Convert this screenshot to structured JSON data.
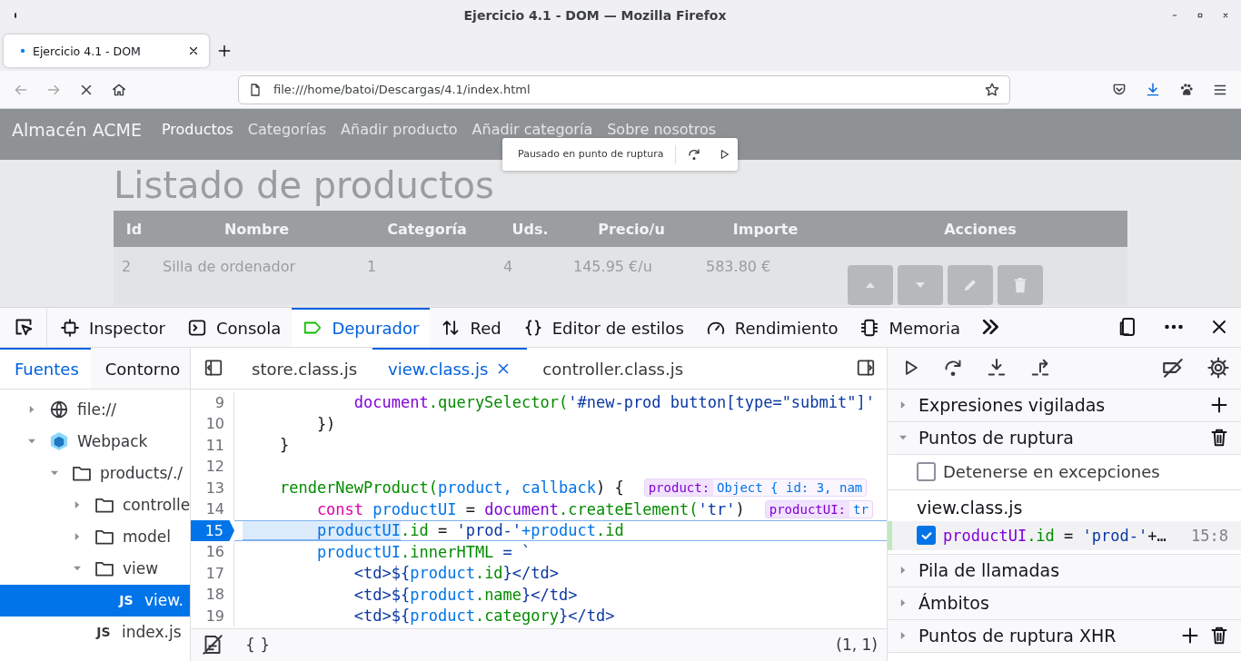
{
  "window": {
    "title": "Ejercicio 4.1 - DOM — Mozilla Firefox"
  },
  "browser_tabs": [
    {
      "label": "Ejercicio 4.1 - DOM",
      "selected": true
    }
  ],
  "address_bar": {
    "url": "file:///home/batoi/Descargas/4.1/index.html"
  },
  "page": {
    "brand": "Almacén ACME",
    "nav": [
      {
        "label": "Productos",
        "selected": true
      },
      {
        "label": "Categorías",
        "selected": false
      },
      {
        "label": "Añadir producto",
        "selected": false
      },
      {
        "label": "Añadir categoría",
        "selected": false
      },
      {
        "label": "Sobre nosotros",
        "selected": false
      }
    ],
    "pause_overlay": {
      "message": "Pausado en punto de ruptura"
    },
    "heading": "Listado de productos",
    "table": {
      "columns": [
        "Id",
        "Nombre",
        "Categoría",
        "Uds.",
        "Precio/u",
        "Importe",
        "Acciones"
      ],
      "rows": [
        {
          "cells": [
            "2",
            "Silla de ordenador",
            "1",
            "4",
            "145.95 €/u",
            "583.80 €"
          ],
          "actions": [
            {
              "kind": "up"
            },
            {
              "kind": "down"
            },
            {
              "kind": "edit"
            },
            {
              "kind": "delete"
            }
          ]
        }
      ]
    }
  },
  "devtools": {
    "tabs": [
      {
        "label": "Inspector",
        "kind": "inspector",
        "selected": false
      },
      {
        "label": "Consola",
        "kind": "console",
        "selected": false
      },
      {
        "label": "Depurador",
        "kind": "debugger",
        "selected": true
      },
      {
        "label": "Red",
        "kind": "network",
        "selected": false
      },
      {
        "label": "Editor de estilos",
        "kind": "style",
        "selected": false
      },
      {
        "label": "Rendimiento",
        "kind": "performance",
        "selected": false
      },
      {
        "label": "Memoria",
        "kind": "memory",
        "selected": false
      }
    ],
    "sources": {
      "tabs": [
        {
          "label": "Fuentes",
          "selected": true
        },
        {
          "label": "Contorno",
          "selected": false
        }
      ],
      "tree": [
        {
          "label": "file://",
          "kind": "origin",
          "expanded": false,
          "selected": false
        },
        {
          "label": "Webpack",
          "kind": "webpack",
          "expanded": true,
          "selected": false,
          "children": [
            {
              "label": "products/./",
              "kind": "folder",
              "expanded": true,
              "selected": false,
              "children": [
                {
                  "label": "controlle",
                  "kind": "folder",
                  "expanded": false,
                  "selected": false
                },
                {
                  "label": "model",
                  "kind": "folder",
                  "expanded": false,
                  "selected": false
                },
                {
                  "label": "view",
                  "kind": "folder",
                  "expanded": true,
                  "selected": false,
                  "children": [
                    {
                      "label": "view.",
                      "kind": "file",
                      "badge": "JS",
                      "selected": true
                    }
                  ]
                },
                {
                  "label": "index.js",
                  "kind": "file",
                  "badge": "JS",
                  "selected": false
                }
              ]
            }
          ]
        }
      ]
    },
    "editor": {
      "tabs": [
        {
          "label": "store.class.js",
          "selected": false
        },
        {
          "label": "view.class.js",
          "selected": true
        },
        {
          "label": "controller.class.js",
          "selected": false
        }
      ],
      "lines": [
        {
          "number": "9",
          "paused": false,
          "tokens": [
            {
              "text": "            document",
              "kind": "object"
            },
            {
              "text": ".querySelector(",
              "kind": "method"
            },
            {
              "text": "'#new-prod button[type=\"submit\"]'",
              "kind": "string"
            }
          ]
        },
        {
          "number": "10",
          "paused": false,
          "tokens": [
            {
              "text": "        })",
              "kind": "plain"
            }
          ]
        },
        {
          "number": "11",
          "paused": false,
          "tokens": [
            {
              "text": "    }",
              "kind": "plain"
            }
          ]
        },
        {
          "number": "12",
          "paused": false
        },
        {
          "number": "13",
          "paused": false,
          "tokens": [
            {
              "text": "    renderNewProduct(",
              "kind": "method"
            },
            {
              "text": "product",
              "kind": "variable"
            },
            {
              "text": ", callback",
              "kind": "variable"
            },
            {
              "text": ") {",
              "kind": "plain"
            }
          ],
          "preview": {
            "label": "product:",
            "value": "Object { id: 3, nam"
          }
        },
        {
          "number": "14",
          "paused": false,
          "tokens": [
            {
              "text": "        const",
              "kind": "keyword"
            },
            {
              "text": " productUI",
              "kind": "variable"
            },
            {
              "text": " = ",
              "kind": "plain"
            },
            {
              "text": "document",
              "kind": "object"
            },
            {
              "text": ".createElement(",
              "kind": "method"
            },
            {
              "text": "'tr'",
              "kind": "string"
            },
            {
              "text": ")",
              "kind": "plain"
            }
          ],
          "preview": {
            "label": "productUI:",
            "value": "tr"
          }
        },
        {
          "number": "15",
          "paused": true,
          "tokens": [
            {
              "text": "        productUI",
              "kind": "paused-expression"
            },
            {
              "text": ".id",
              "kind": "property"
            },
            {
              "text": " = ",
              "kind": "plain"
            },
            {
              "text": "'prod-'",
              "kind": "string"
            },
            {
              "text": "+product",
              "kind": "variable"
            },
            {
              "text": ".id",
              "kind": "property"
            }
          ]
        },
        {
          "number": "16",
          "paused": false,
          "tokens": [
            {
              "text": "        productUI",
              "kind": "variable"
            },
            {
              "text": ".innerHTML",
              "kind": "property"
            },
            {
              "text": " = `",
              "kind": "string"
            }
          ]
        },
        {
          "number": "17",
          "paused": false,
          "tokens": [
            {
              "text": "            <td>${",
              "kind": "string"
            },
            {
              "text": "product",
              "kind": "variable"
            },
            {
              "text": ".id",
              "kind": "property"
            },
            {
              "text": "}</td>",
              "kind": "string"
            }
          ]
        },
        {
          "number": "18",
          "paused": false,
          "tokens": [
            {
              "text": "            <td>${",
              "kind": "string"
            },
            {
              "text": "product",
              "kind": "variable"
            },
            {
              "text": ".name",
              "kind": "property"
            },
            {
              "text": "}</td>",
              "kind": "string"
            }
          ]
        },
        {
          "number": "19",
          "paused": false,
          "tokens": [
            {
              "text": "            <td>${",
              "kind": "string"
            },
            {
              "text": "product",
              "kind": "variable"
            },
            {
              "text": ".category",
              "kind": "property"
            },
            {
              "text": "}</td>",
              "kind": "string"
            }
          ]
        }
      ],
      "pretty_print": "{ }",
      "cursor": "(1, 1)"
    },
    "sidebar": {
      "sections": [
        {
          "title": "Expresiones vigiladas",
          "expanded": false,
          "actions": [
            {
              "kind": "add"
            }
          ]
        },
        {
          "title": "Puntos de ruptura",
          "expanded": true,
          "actions": [
            {
              "kind": "remove"
            }
          ],
          "pause_on_exceptions": {
            "label": "Detenerse en excepciones",
            "checked": false
          },
          "groups": [
            {
              "file": "view.class.js",
              "breakpoints": [
                {
                  "tokens": [
                    {
                      "text": "productUI",
                      "kind": "object"
                    },
                    {
                      "text": ".id",
                      "kind": "property"
                    },
                    {
                      "text": " = ",
                      "kind": "plain"
                    },
                    {
                      "text": "'prod-'",
                      "kind": "string"
                    },
                    {
                      "text": "+…",
                      "kind": "plain"
                    }
                  ],
                  "location": "15:8",
                  "enabled": true
                }
              ]
            }
          ]
        },
        {
          "title": "Pila de llamadas",
          "expanded": false
        },
        {
          "title": "Ámbitos",
          "expanded": false
        },
        {
          "title": "Puntos de ruptura XHR",
          "expanded": false,
          "actions": [
            {
              "kind": "add"
            },
            {
              "kind": "remove"
            }
          ]
        }
      ]
    }
  }
}
